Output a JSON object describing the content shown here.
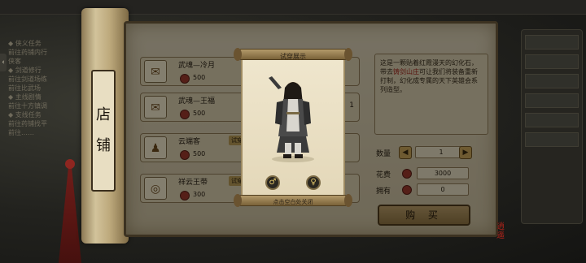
{
  "background": {
    "topbar_label": "",
    "left_panel_lines": [
      "◆ 侠义任务",
      "  前往药铺内行",
      "  侠客",
      "◆ 剑道修行",
      "  前往剑道场练",
      "  前往比武场",
      "◆ 主线剧情",
      "  前往十方镇调",
      "◆ 支线任务",
      "  前往药铺找平",
      "  前往……"
    ],
    "right_panel_strips": [
      "",
      "",
      "",
      "",
      "",
      ""
    ]
  },
  "shop": {
    "sign_chars": [
      "店",
      "铺"
    ],
    "items": [
      {
        "name": "武魂—冷月",
        "price": "500",
        "icon": "scroll-icon",
        "tag": "",
        "count": ""
      },
      {
        "name": "武魂—王福",
        "price": "500",
        "icon": "scroll-icon",
        "tag": "",
        "count": "1"
      },
      {
        "name": "云端客",
        "price": "500",
        "icon": "outfit-icon",
        "tag": "试穿",
        "count": ""
      },
      {
        "name": "祥云王带",
        "price": "300",
        "icon": "belt-icon",
        "tag": "试穿",
        "count": ""
      }
    ],
    "description": {
      "part1": "这是一颗贴着红霞漫天的幻化石，带去",
      "highlight": "铸剑山庄",
      "part2": "可让我们将装备重新打制，幻化成专属的天下英雄会系列造型。"
    },
    "quantity_label": "数量",
    "quantity_value": "1",
    "cost_label": "花费",
    "cost_value": "3000",
    "own_label": "拥有",
    "own_value": "0",
    "buy_label": "购 买",
    "seal_text": "逍遥"
  },
  "preview": {
    "title": "试穿展示",
    "close_hint": "点击空白处关闭",
    "male_symbol": "♂",
    "female_symbol": "♀"
  },
  "colors": {
    "accent_red": "#a0241a",
    "parchment": "#d9cfb4",
    "frame_brown": "#6d5c3c"
  }
}
